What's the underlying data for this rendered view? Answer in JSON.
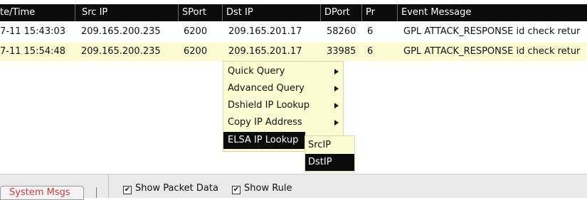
{
  "table": {
    "headers": [
      "te/Time",
      "Src IP",
      "SPort",
      "Dst IP",
      "DPort",
      "Pr",
      "Event Message"
    ],
    "rows": [
      [
        "7-11 15:43:03",
        "209.165.200.235",
        "6200",
        "209.165.201.17",
        "58260",
        "6",
        "GPL ATTACK_RESPONSE id check retur"
      ],
      [
        "7-11 15:54:48",
        "209.165.200.235",
        "6200",
        "209.165.201.17",
        "33985",
        "6",
        "GPL ATTACK_RESPONSE id check retur"
      ]
    ]
  },
  "context_menu": {
    "items": [
      "Quick Query",
      "Advanced Query",
      "Dshield IP Lookup",
      "Copy IP Address",
      "ELSA IP Lookup"
    ],
    "submenu_items": [
      "SrcIP",
      "DstIP"
    ]
  },
  "bottom_bar": {
    "tab_label": "System Msgs",
    "show_packet_data": "Show Packet Data",
    "show_rule": "Show Rule",
    "check_mark": "✔"
  },
  "colors": {
    "header_bg": "#0b0b0b",
    "highlight_row": "#fbfbd2",
    "tab_text": "#d23a3a"
  }
}
